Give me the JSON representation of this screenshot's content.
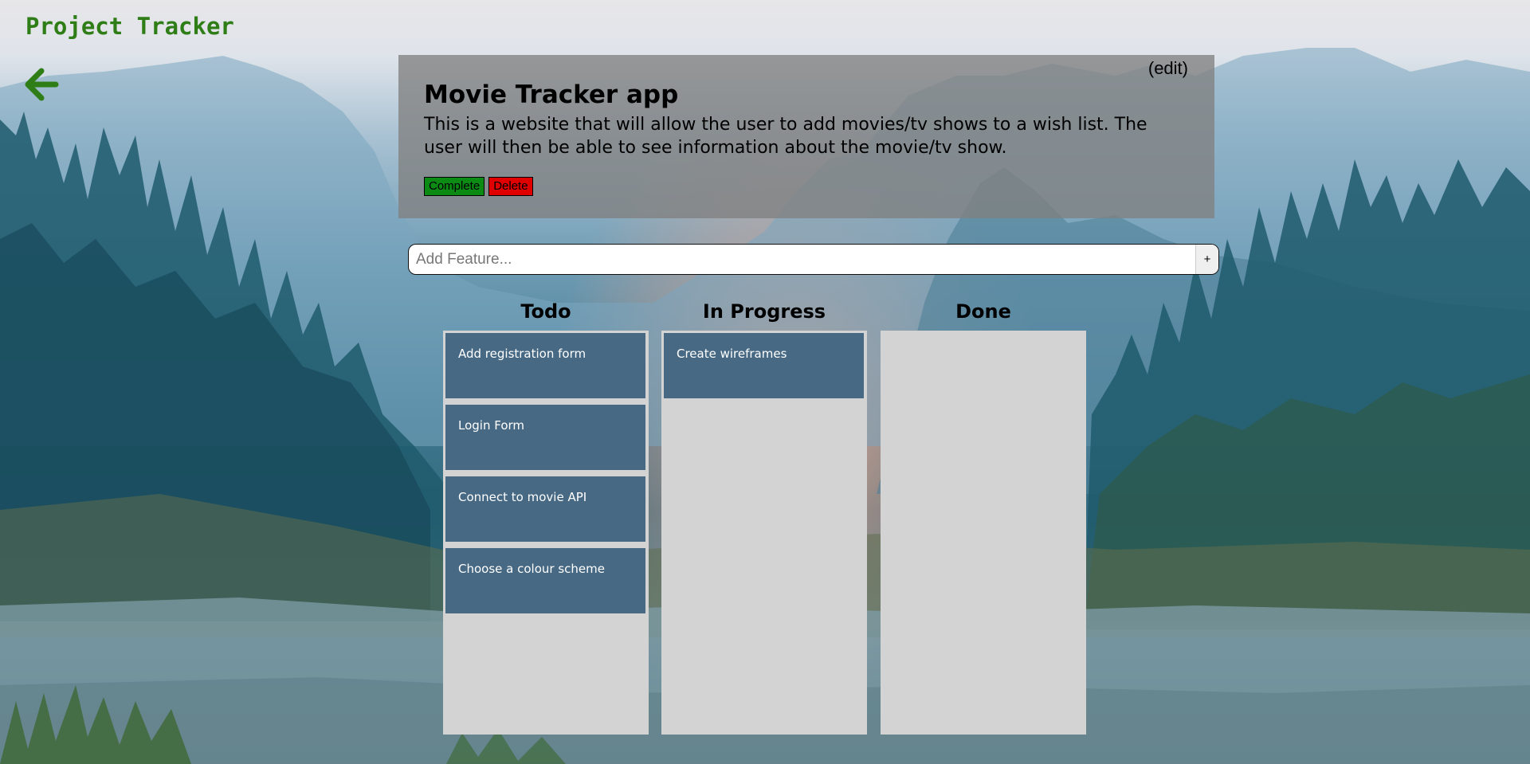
{
  "app": {
    "title": "Project Tracker"
  },
  "icons": {
    "back": "arrow-left-icon",
    "add": "plus-icon"
  },
  "colors": {
    "brand": "#2f7d17",
    "card": "#476984",
    "column": "#d3d3d3",
    "complete": "#0b8a14",
    "delete": "#e00000"
  },
  "project": {
    "edit_label": "(edit)",
    "title": "Movie Tracker app",
    "description": "This is a website that will allow the user to add movies/tv shows to a wish list. The user will then be able to see information about the movie/tv show.",
    "complete_label": "Complete",
    "delete_label": "Delete"
  },
  "add_feature": {
    "placeholder": "Add Feature...",
    "value": "",
    "button_label": "+"
  },
  "board": {
    "columns": [
      {
        "title": "Todo",
        "cards": [
          "Add registration form",
          "Login Form",
          "Connect to movie API",
          "Choose a colour scheme"
        ]
      },
      {
        "title": "In Progress",
        "cards": [
          "Create wireframes"
        ]
      },
      {
        "title": "Done",
        "cards": []
      }
    ]
  }
}
